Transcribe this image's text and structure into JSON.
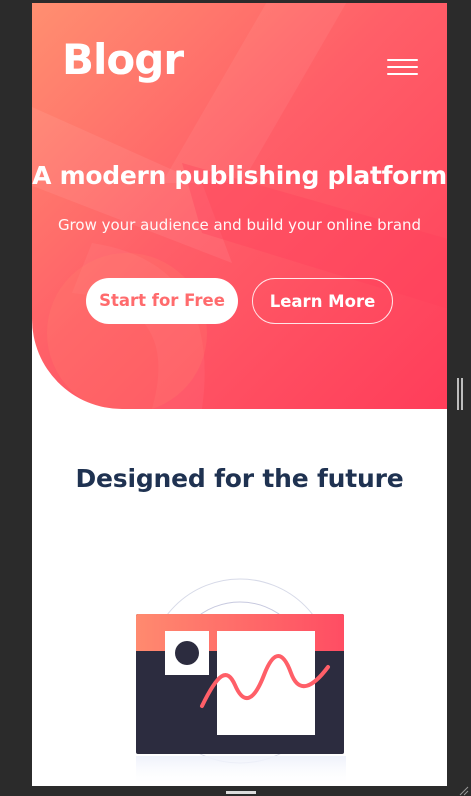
{
  "header": {
    "logo": "Blogr",
    "menu_icon": "hamburger-icon"
  },
  "hero": {
    "title": "A modern publishing platform",
    "subtitle": "Grow your audience and build your online brand",
    "primary_button": "Start for Free",
    "secondary_button": "Learn More"
  },
  "section": {
    "title": "Designed for the future"
  },
  "colors": {
    "hero_gradient_start": "#ff8f70",
    "hero_gradient_end": "#ff3d5a",
    "primary_button_text": "#ff6b6d",
    "heading": "#1f3251",
    "illustration_dark": "#2c2c3f"
  },
  "icons": {
    "menu": "hamburger-icon",
    "illustration": "editor-illustration"
  }
}
